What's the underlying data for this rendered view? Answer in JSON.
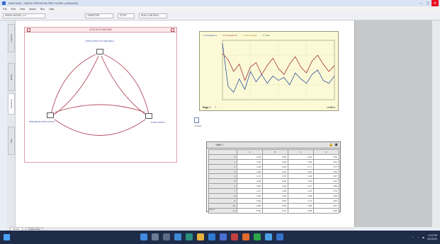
{
  "window": {
    "title": "IMMITHINK - SIMPLE PREDATOR-PREY MODEL (UNSAVED)"
  },
  "menu": [
    "File",
    "Edit",
    "View",
    "Model",
    "Run",
    "Help"
  ],
  "toolbar": {
    "fields": [
      "DEMO MODEL 1.0",
      "TIMESTEP",
      "STOP",
      "RUN CONTROL"
    ]
  },
  "left_tabs": [
    "Interface",
    "Model",
    "Equations",
    "Map"
  ],
  "diagram": {
    "header": "STOCK-FLOW MAP",
    "nodes": [
      {
        "label": "POPULATION OF SPECIES A"
      },
      {
        "label": "SPECIES B POPULATION"
      },
      {
        "label": "FOOD SUPPLY"
      }
    ],
    "colors": {
      "border": "#d9a0a8",
      "links": "#b44a5e"
    }
  },
  "line_chart": {
    "legend": [
      "1: Population A",
      "2: Population B",
      "3: Food Supply",
      "4: Total"
    ],
    "page": "Page 1",
    "footer": "Untitled"
  },
  "chart_data": {
    "type": "line",
    "x": [
      0,
      1,
      2,
      3,
      4,
      5,
      6,
      7,
      8,
      9,
      10,
      11,
      12,
      13,
      14,
      15,
      16,
      17,
      18,
      19,
      20
    ],
    "series": [
      {
        "values": [
          3.8,
          0.9,
          0.5,
          1.4,
          0.7,
          1.9,
          1.2,
          1.7,
          1.1,
          1.6,
          1.3,
          1.5,
          1.0,
          1.8,
          1.4,
          1.1,
          1.7,
          2.0,
          1.3,
          1.1,
          1.6
        ]
      },
      {
        "values": [
          3.1,
          2.7,
          1.9,
          2.4,
          1.3,
          2.2,
          2.5,
          1.7,
          2.3,
          2.8,
          2.1,
          1.7,
          2.4,
          2.9,
          2.2,
          1.8,
          2.6,
          3.0,
          2.4,
          1.9,
          2.3
        ]
      }
    ],
    "ylim": [
      0,
      4
    ]
  },
  "table": {
    "title": "Table 1",
    "headers": [
      "",
      "A",
      "B",
      "C",
      "D"
    ],
    "rows": [
      [
        "0",
        "1.00",
        "0.50",
        "2.00",
        "3.50"
      ],
      [
        "1",
        "1.25",
        "0.48",
        "1.90",
        "3.63"
      ],
      [
        "2",
        "1.48",
        "0.52",
        "1.77",
        "3.77"
      ],
      [
        "3",
        "1.66",
        "0.61",
        "1.62",
        "3.89"
      ],
      [
        "4",
        "1.74",
        "0.75",
        "1.48",
        "3.97"
      ],
      [
        "5",
        "1.68",
        "0.90",
        "1.39",
        "3.97"
      ],
      [
        "6",
        "1.50",
        "1.02",
        "1.37",
        "3.89"
      ],
      [
        "7",
        "1.27",
        "1.08",
        "1.44",
        "3.79"
      ],
      [
        "8",
        "1.06",
        "1.05",
        "1.58",
        "3.69"
      ],
      [
        "9",
        "0.93",
        "0.96",
        "1.74",
        "3.63"
      ],
      [
        "10",
        "0.89",
        "0.84",
        "1.88",
        "3.61"
      ],
      [
        "11",
        "0.95",
        "0.72",
        "1.98",
        "3.65"
      ]
    ],
    "footer": "Page 1"
  },
  "bottom_tabs": [
    "Model1",
    "Untitled Map"
  ],
  "tray": {
    "time": "4:15 PM",
    "date": "6/2/2024"
  }
}
